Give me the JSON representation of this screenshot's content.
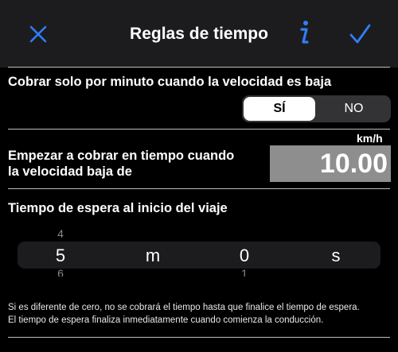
{
  "nav": {
    "title": "Reglas de tiempo",
    "close_icon": "close-icon",
    "info_icon": "info-icon",
    "confirm_icon": "checkmark-icon",
    "accent_color": "#2f7ef6"
  },
  "low_speed": {
    "label": "Cobrar solo por minuto cuando la velocidad es baja",
    "options": [
      "SÍ",
      "NO"
    ],
    "selected": "SÍ"
  },
  "speed_threshold": {
    "label_line1": "Empezar a cobrar en tiempo cuando",
    "label_line2": "la velocidad baja de",
    "unit": "km/h",
    "value": "10.00"
  },
  "wait_time": {
    "label": "Tiempo de espera al inicio del viaje",
    "minutes": {
      "above": "4",
      "selected": "5",
      "below": "6",
      "unit": "m"
    },
    "seconds": {
      "above": "",
      "selected": "0",
      "below": "1",
      "unit": "s"
    }
  },
  "note": {
    "line1": "Si es diferente de cero, no se cobrará el tiempo hasta que finalice el tiempo de espera.",
    "line2": "El tiempo de espera finaliza inmediatamente cuando comienza la conducción."
  }
}
